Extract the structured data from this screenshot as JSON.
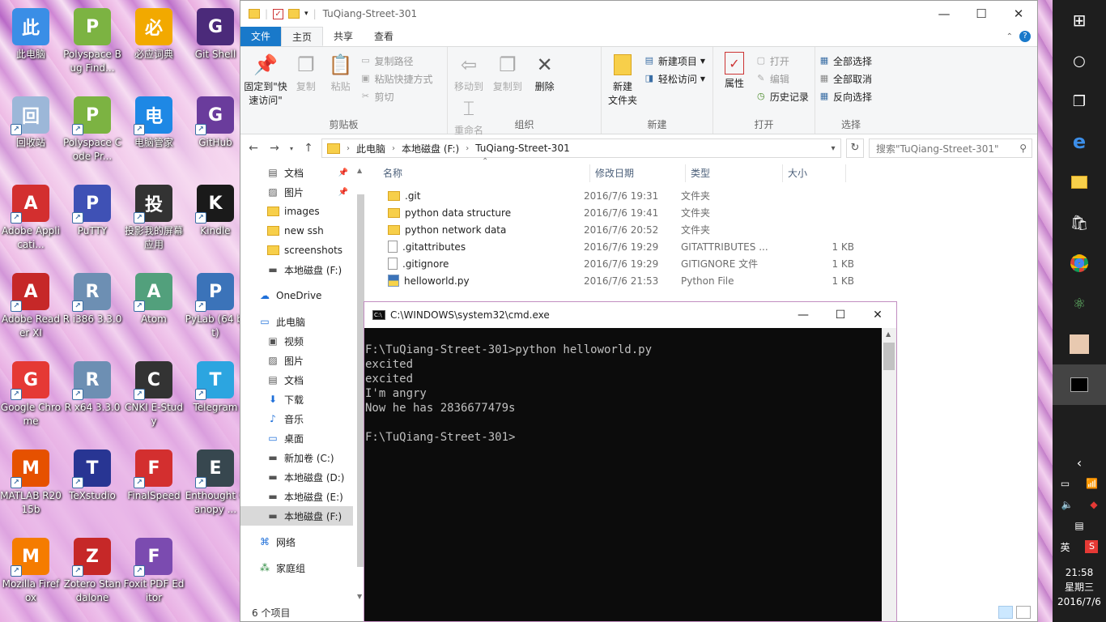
{
  "desktop": {
    "icons": [
      {
        "label": "此电脑",
        "icon": "computer-icon",
        "color": "#3a8ee6"
      },
      {
        "label": "Polyspace Bug Find...",
        "icon": "polyspace-icon",
        "color": "#7cb342"
      },
      {
        "label": "必应词典",
        "icon": "bing-dict-icon",
        "color": "#f2a900"
      },
      {
        "label": "Git Shell",
        "icon": "terminal-icon",
        "color": "#4b2a7a"
      },
      {
        "label": "回收站",
        "icon": "recycle-bin-icon",
        "color": "#9cb7d8"
      },
      {
        "label": "Polyspace Code Pr...",
        "icon": "polyspace-icon",
        "color": "#7cb342"
      },
      {
        "label": "电脑管家",
        "icon": "shield-icon",
        "color": "#1e88e5"
      },
      {
        "label": "GitHub",
        "icon": "github-icon",
        "color": "#6a3c9c"
      },
      {
        "label": "Adobe Applicati...",
        "icon": "adobe-icon",
        "color": "#d32f2f"
      },
      {
        "label": "PuTTY",
        "icon": "putty-icon",
        "color": "#3f51b5"
      },
      {
        "label": "投影我的屏幕应用",
        "icon": "phone-icon",
        "color": "#333333"
      },
      {
        "label": "Kindle",
        "icon": "kindle-icon",
        "color": "#1a1a1a"
      },
      {
        "label": "Adobe Reader XI",
        "icon": "pdf-icon",
        "color": "#c62828"
      },
      {
        "label": "R i386 3.3.0",
        "icon": "r-icon",
        "color": "#6d8fb3"
      },
      {
        "label": "Atom",
        "icon": "atom-icon",
        "color": "#52a07c"
      },
      {
        "label": "PyLab (64 bit)",
        "icon": "python-icon",
        "color": "#3b73b9"
      },
      {
        "label": "Google Chrome",
        "icon": "chrome-icon",
        "color": "#e53935"
      },
      {
        "label": "R x64 3.3.0",
        "icon": "r-icon",
        "color": "#6d8fb3"
      },
      {
        "label": "CNKI E-Study",
        "icon": "pen-icon",
        "color": "#333333"
      },
      {
        "label": "Telegram",
        "icon": "telegram-icon",
        "color": "#2ca5e0"
      },
      {
        "label": "MATLAB R2015b",
        "icon": "matlab-icon",
        "color": "#e65100"
      },
      {
        "label": "TeXstudio",
        "icon": "tex-icon",
        "color": "#283593"
      },
      {
        "label": "FinalSpeed",
        "icon": "arrow-icon",
        "color": "#d32f2f"
      },
      {
        "label": "Enthought Canopy ...",
        "icon": "canopy-icon",
        "color": "#37474f"
      },
      {
        "label": "Mozilla Firefox",
        "icon": "firefox-icon",
        "color": "#f57c00"
      },
      {
        "label": "Zotero Standalone",
        "icon": "zotero-icon",
        "color": "#c62828"
      },
      {
        "label": "Foxit PDF Editor",
        "icon": "foxit-icon",
        "color": "#7b4bb0"
      }
    ]
  },
  "explorer": {
    "title": "TuQiang-Street-301",
    "tabs": {
      "file": "文件",
      "home": "主页",
      "share": "共享",
      "view": "查看"
    },
    "ribbon": {
      "clipboard": {
        "pin": "固定到\"快速访问\"",
        "copy": "复制",
        "paste": "粘贴",
        "copy_path": "复制路径",
        "paste_shortcut": "粘贴快捷方式",
        "cut": "剪切",
        "name": "剪贴板"
      },
      "organize": {
        "move_to": "移动到",
        "copy_to": "复制到",
        "delete": "删除",
        "rename": "重命名",
        "name": "组织"
      },
      "new": {
        "new_folder": "新建\n文件夹",
        "new_item": "新建项目",
        "easy_access": "轻松访问",
        "name": "新建"
      },
      "open": {
        "properties": "属性",
        "open": "打开",
        "edit": "编辑",
        "history": "历史记录",
        "name": "打开"
      },
      "select": {
        "select_all": "全部选择",
        "select_none": "全部取消",
        "invert": "反向选择",
        "name": "选择"
      }
    },
    "address": {
      "crumbs": [
        "此电脑",
        "本地磁盘 (F:)",
        "TuQiang-Street-301"
      ],
      "search_placeholder": "搜索\"TuQiang-Street-301\""
    },
    "nav": [
      {
        "label": "文档",
        "icon": "document-icon",
        "pinned": true
      },
      {
        "label": "图片",
        "icon": "picture-icon",
        "pinned": true
      },
      {
        "label": "images",
        "icon": "folder-icon"
      },
      {
        "label": "new ssh",
        "icon": "folder-icon"
      },
      {
        "label": "screenshots",
        "icon": "folder-icon"
      },
      {
        "label": "本地磁盘 (F:)",
        "icon": "drive-icon"
      },
      {
        "label": "OneDrive",
        "icon": "cloud-icon"
      },
      {
        "label": "此电脑",
        "icon": "computer-icon"
      },
      {
        "label": "视频",
        "icon": "video-icon"
      },
      {
        "label": "图片",
        "icon": "picture-icon"
      },
      {
        "label": "文档",
        "icon": "document-icon"
      },
      {
        "label": "下载",
        "icon": "download-icon"
      },
      {
        "label": "音乐",
        "icon": "music-icon"
      },
      {
        "label": "桌面",
        "icon": "desktop-icon"
      },
      {
        "label": "新加卷 (C:)",
        "icon": "drive-icon"
      },
      {
        "label": "本地磁盘 (D:)",
        "icon": "drive-icon"
      },
      {
        "label": "本地磁盘 (E:)",
        "icon": "drive-icon"
      },
      {
        "label": "本地磁盘 (F:)",
        "icon": "drive-icon"
      },
      {
        "label": "网络",
        "icon": "network-icon"
      },
      {
        "label": "家庭组",
        "icon": "homegroup-icon"
      }
    ],
    "columns": {
      "name": "名称",
      "date": "修改日期",
      "type": "类型",
      "size": "大小"
    },
    "files": [
      {
        "name": ".git",
        "date": "2016/7/6 19:31",
        "type": "文件夹",
        "size": "",
        "kind": "folder"
      },
      {
        "name": "python data structure",
        "date": "2016/7/6 19:41",
        "type": "文件夹",
        "size": "",
        "kind": "folder"
      },
      {
        "name": "python network data",
        "date": "2016/7/6 20:52",
        "type": "文件夹",
        "size": "",
        "kind": "folder"
      },
      {
        "name": ".gitattributes",
        "date": "2016/7/6 19:29",
        "type": "GITATTRIBUTES ...",
        "size": "1 KB",
        "kind": "file"
      },
      {
        "name": ".gitignore",
        "date": "2016/7/6 19:29",
        "type": "GITIGNORE 文件",
        "size": "1 KB",
        "kind": "file"
      },
      {
        "name": "helloworld.py",
        "date": "2016/7/6 21:53",
        "type": "Python File",
        "size": "1 KB",
        "kind": "python"
      }
    ],
    "status": "6 个项目"
  },
  "cmd": {
    "title": "C:\\WINDOWS\\system32\\cmd.exe",
    "lines": [
      "F:\\TuQiang-Street-301>python helloworld.py",
      "excited",
      "excited",
      "I'm angry",
      "Now he has 2836677479s",
      "",
      "F:\\TuQiang-Street-301>"
    ]
  },
  "taskbar": {
    "tray": {
      "ime": "英",
      "time": "21:58",
      "weekday": "星期三",
      "date": "2016/7/6"
    }
  }
}
